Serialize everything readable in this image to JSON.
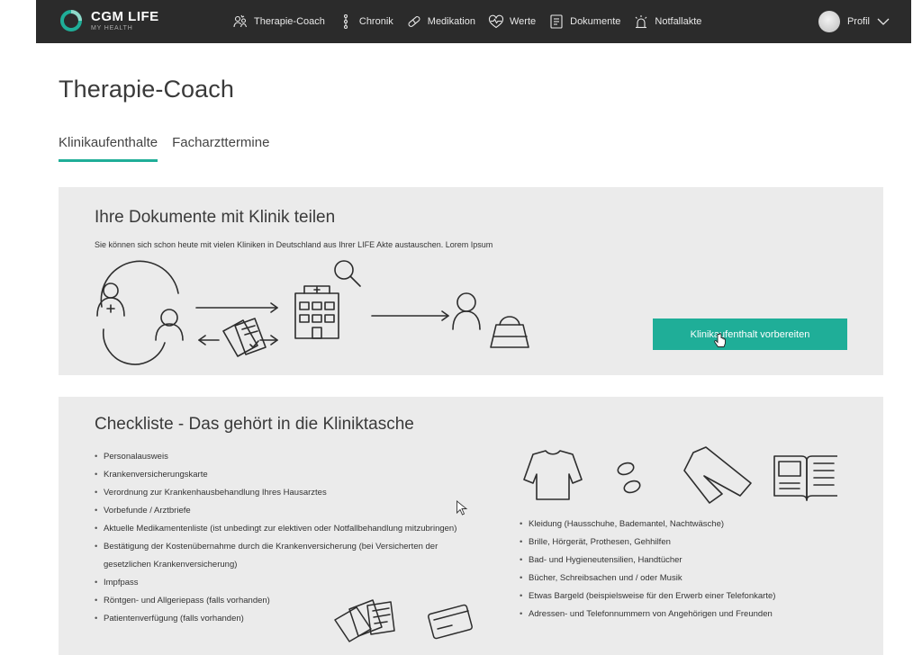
{
  "app": {
    "brand_name": "CGM LIFE",
    "brand_sub": "MY HEALTH"
  },
  "nav": {
    "items": [
      {
        "label": "Therapie-Coach",
        "icon": "therapy-coach-icon"
      },
      {
        "label": "Chronik",
        "icon": "chronicle-icon"
      },
      {
        "label": "Medikation",
        "icon": "pill-icon"
      },
      {
        "label": "Werte",
        "icon": "heart-pulse-icon"
      },
      {
        "label": "Dokumente",
        "icon": "document-icon"
      },
      {
        "label": "Notfallakte",
        "icon": "emergency-light-icon"
      }
    ],
    "profile_label": "Profil"
  },
  "page": {
    "title": "Therapie-Coach",
    "tabs": [
      {
        "label": "Klinikaufenthalte",
        "active": true
      },
      {
        "label": "Facharzttermine",
        "active": false
      }
    ]
  },
  "share_panel": {
    "title": "Ihre Dokumente mit Klinik teilen",
    "description": "Sie können sich schon heute mit vielen Kliniken in Deutschland aus Ihrer LIFE Akte austauschen. Lorem Ipsum",
    "cta_label": "Klinikaufenthalt vorbereiten"
  },
  "checklist_panel": {
    "title": "Checkliste - Das gehört in die Kliniktasche",
    "left_items": [
      "Personalausweis",
      "Krankenversicherungskarte",
      "Verordnung zur Krankenhausbehandlung Ihres Hausarztes",
      "Vorbefunde / Arztbriefe",
      "Aktuelle Medikamentenliste (ist unbedingt zur elektiven oder Notfallbehandlung mitzubringen)",
      "Bestätigung der Kostenübernahme durch die Krankenversicherung (bei Versicherten der gesetzlichen Krankenversicherung)",
      "Impfpass",
      "Röntgen- und Allgeriepass (falls vorhanden)",
      "Patientenverfügung (falls vorhanden)"
    ],
    "right_items": [
      "Kleidung (Hausschuhe, Bademantel, Nachtwäsche)",
      "Brille, Hörgerät, Prothesen, Gehhilfen",
      "Bad- und Hygieneutensilien, Handtücher",
      "Bücher, Schreibsachen und / oder Musik",
      "Etwas Bargeld (beispielsweise für den Erwerb einer Telefonkarte)",
      "Adressen- und Telefonnummern von Angehörigen und Freunden"
    ]
  },
  "colors": {
    "topbar": "#2b2b2b",
    "accent": "#1fae98",
    "panel": "#ebebeb"
  }
}
